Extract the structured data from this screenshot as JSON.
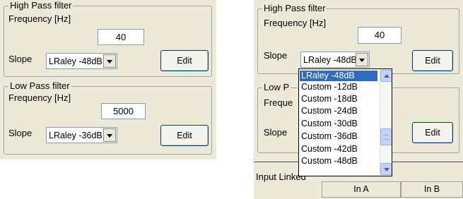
{
  "left": {
    "highpass": {
      "title": "High Pass filter",
      "freq_label": "Frequency [Hz]",
      "freq_value": "40",
      "slope_label": "Slope",
      "slope_value": "LRaley -48dB",
      "edit_label": "Edit"
    },
    "lowpass": {
      "title": "Low Pass filter",
      "freq_label": "Frequency [Hz]",
      "freq_value": "5000",
      "slope_label": "Slope",
      "slope_value": "LRaley -36dB",
      "edit_label": "Edit"
    }
  },
  "right": {
    "highpass": {
      "title": "High Pass filter",
      "freq_label": "Frequency [Hz]",
      "freq_value": "40",
      "slope_label": "Slope",
      "slope_value": "LRaley -48dB",
      "edit_label": "Edit"
    },
    "lowpass": {
      "title_partial": "Low P",
      "freq_label_partial": "Freque",
      "slope_label": "Slope",
      "edit_label": "Edit"
    },
    "dropdown": {
      "items": [
        "LRaley -48dB",
        "Custom -12dB",
        "Custom -18dB",
        "Custom -24dB",
        "Custom -30dB",
        "Custom -36dB",
        "Custom -42dB",
        "Custom -48dB"
      ],
      "selected_index": 0
    },
    "input_linked_label": "Input Linked",
    "input_buttons": [
      "In A",
      "In B"
    ]
  }
}
